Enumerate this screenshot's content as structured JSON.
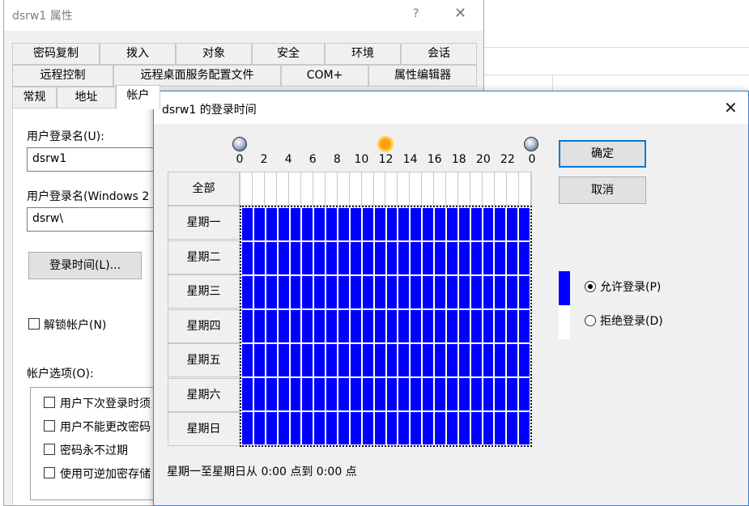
{
  "properties_window": {
    "title": "dsrw1 属性",
    "help_label": "?",
    "close_label": "✕",
    "tabs_row1": [
      "密码复制",
      "拨入",
      "对象",
      "安全",
      "环境",
      "会话"
    ],
    "tabs_row2": [
      "远程控制",
      "远程桌面服务配置文件",
      "COM+",
      "属性编辑器"
    ],
    "tabs_row3": [
      "常规",
      "地址",
      "帐户"
    ],
    "active_tab": "帐户",
    "logon_name_label": "用户登录名(U):",
    "logon_name_value": "dsrw1",
    "logon_name_pre2000_label": "用户登录名(Windows 2",
    "logon_name_pre2000_value": "dsrw\\",
    "logon_hours_button": "登录时间(L)...",
    "unlock_account_label": "解锁帐户(N)",
    "account_options_label": "帐户选项(O):",
    "account_options": [
      "用户下次登录时须",
      "用户不能更改密码",
      "密码永不过期",
      "使用可逆加密存储"
    ]
  },
  "logon_hours_dialog": {
    "title": "dsrw1 的登录时间",
    "close_label": "✕",
    "hour_labels": [
      "0",
      "2",
      "4",
      "6",
      "8",
      "10",
      "12",
      "14",
      "16",
      "18",
      "20",
      "22",
      "0"
    ],
    "all_label": "全部",
    "days": [
      "星期一",
      "星期二",
      "星期三",
      "星期四",
      "星期五",
      "星期六",
      "星期日"
    ],
    "ok_label": "确定",
    "cancel_label": "取消",
    "allow_label": "允许登录(P)",
    "deny_label": "拒绝登录(D)",
    "selected_option": "allow",
    "status_text": "星期一至星期日从 0:00 点到 0:00 点",
    "allowed_color": "#0000ff"
  }
}
